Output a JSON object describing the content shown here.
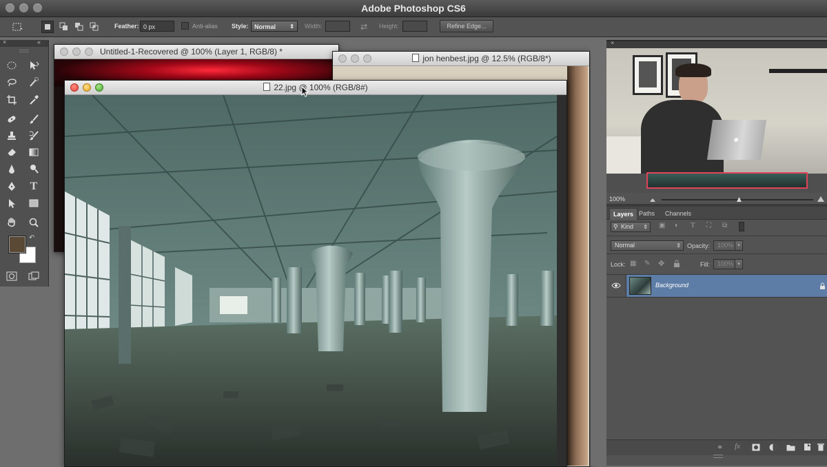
{
  "app": {
    "title": "Adobe Photoshop CS6"
  },
  "options_bar": {
    "feather_label": "Feather:",
    "feather_value": "0 px",
    "antialias_label": "Anti-alias",
    "style_label": "Style:",
    "style_value": "Normal",
    "width_label": "Width:",
    "height_label": "Height:",
    "refine_edge_label": "Refine Edge..."
  },
  "documents": [
    {
      "title": "Untitled-1-Recovered @ 100% (Layer 1, RGB/8) *"
    },
    {
      "title": "jon henbest.jpg @ 12.5% (RGB/8*)"
    },
    {
      "title": "22.jpg @ 100% (RGB/8#)"
    }
  ],
  "navigator": {
    "zoom_value": "100%"
  },
  "layers_panel": {
    "tabs": [
      "Layers",
      "Paths",
      "Channels"
    ],
    "active_tab": 0,
    "filter_value": "Kind",
    "blend_mode": "Normal",
    "opacity_label": "Opacity:",
    "opacity_value": "100%",
    "lock_label": "Lock:",
    "fill_label": "Fill:",
    "fill_value": "100%",
    "layers": [
      {
        "name": "Background",
        "visible": true,
        "locked": true
      }
    ]
  },
  "colors": {
    "foreground": "#5a4a35",
    "background": "#ffffff",
    "selected_layer": "#5d7ca6",
    "panel_dark": "#535353"
  }
}
